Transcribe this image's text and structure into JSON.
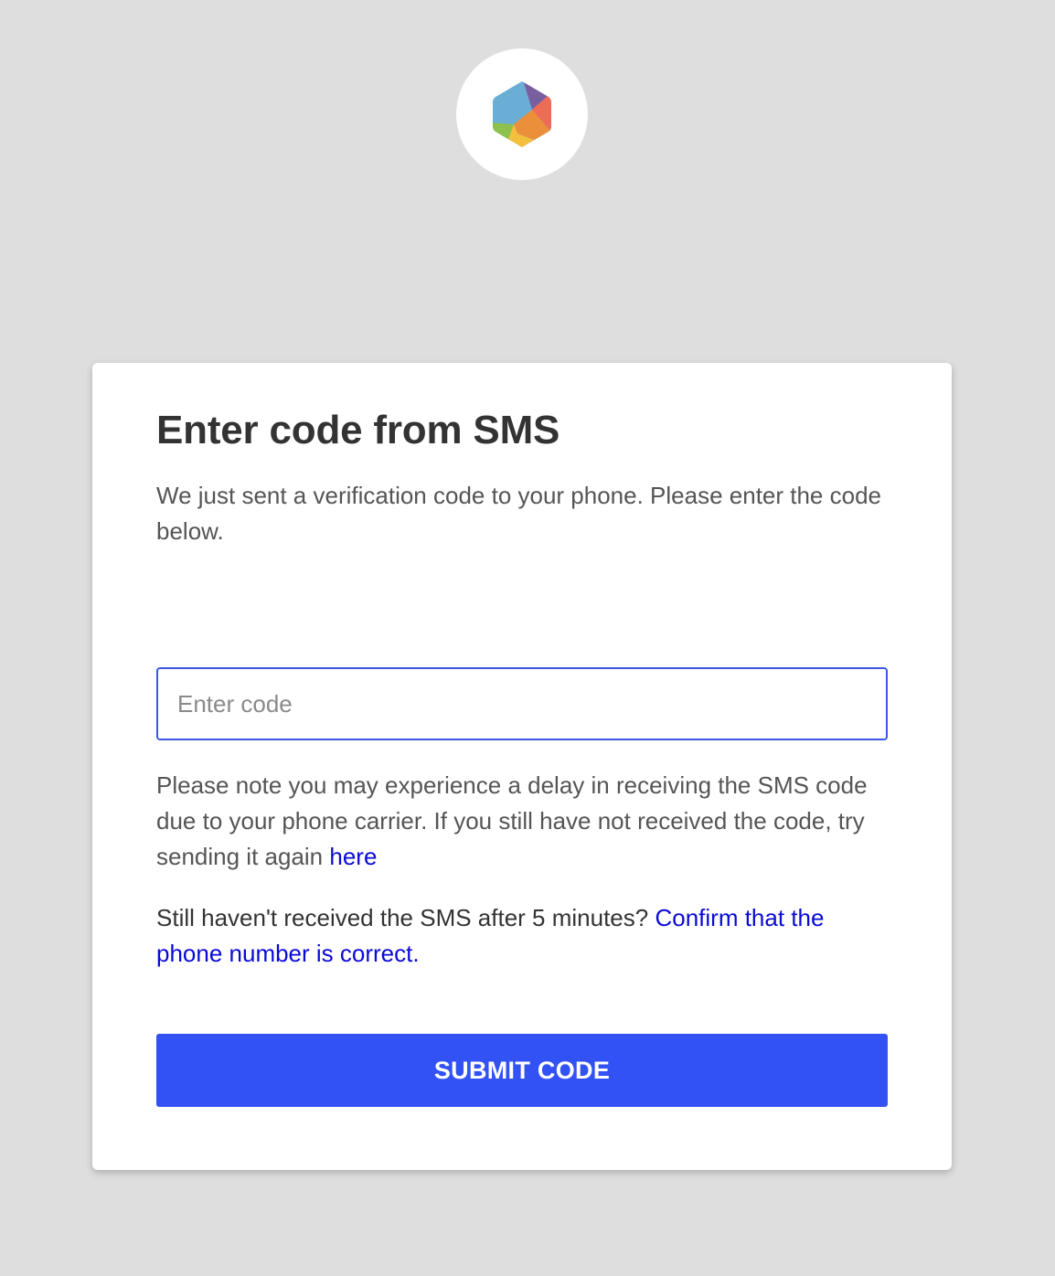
{
  "brand": {
    "logo_icon": "hexagon-logo-icon",
    "logo_colors": [
      "#6aaed6",
      "#7a5fa0",
      "#ee6c55",
      "#ec8f3a",
      "#f4bf3c",
      "#8ec04c"
    ]
  },
  "form": {
    "title": "Enter code from SMS",
    "subtitle": "We just sent a verification code to your phone. Please enter the code below.",
    "code_input": {
      "value": "",
      "placeholder": "Enter code"
    },
    "delay_note": {
      "text": "Please note you may experience a delay in receiving the SMS code due to your phone carrier. If you still have not received the code, try sending it again ",
      "link_text": "here"
    },
    "confirm_note": {
      "text": "Still haven't received the SMS after 5 minutes? ",
      "link_text": "Confirm that the phone number is correct."
    },
    "submit_label": "SUBMIT CODE"
  },
  "colors": {
    "background": "#dedede",
    "accent": "#3352f5",
    "link": "#0a0ad6",
    "input_border": "#3b57e8"
  }
}
